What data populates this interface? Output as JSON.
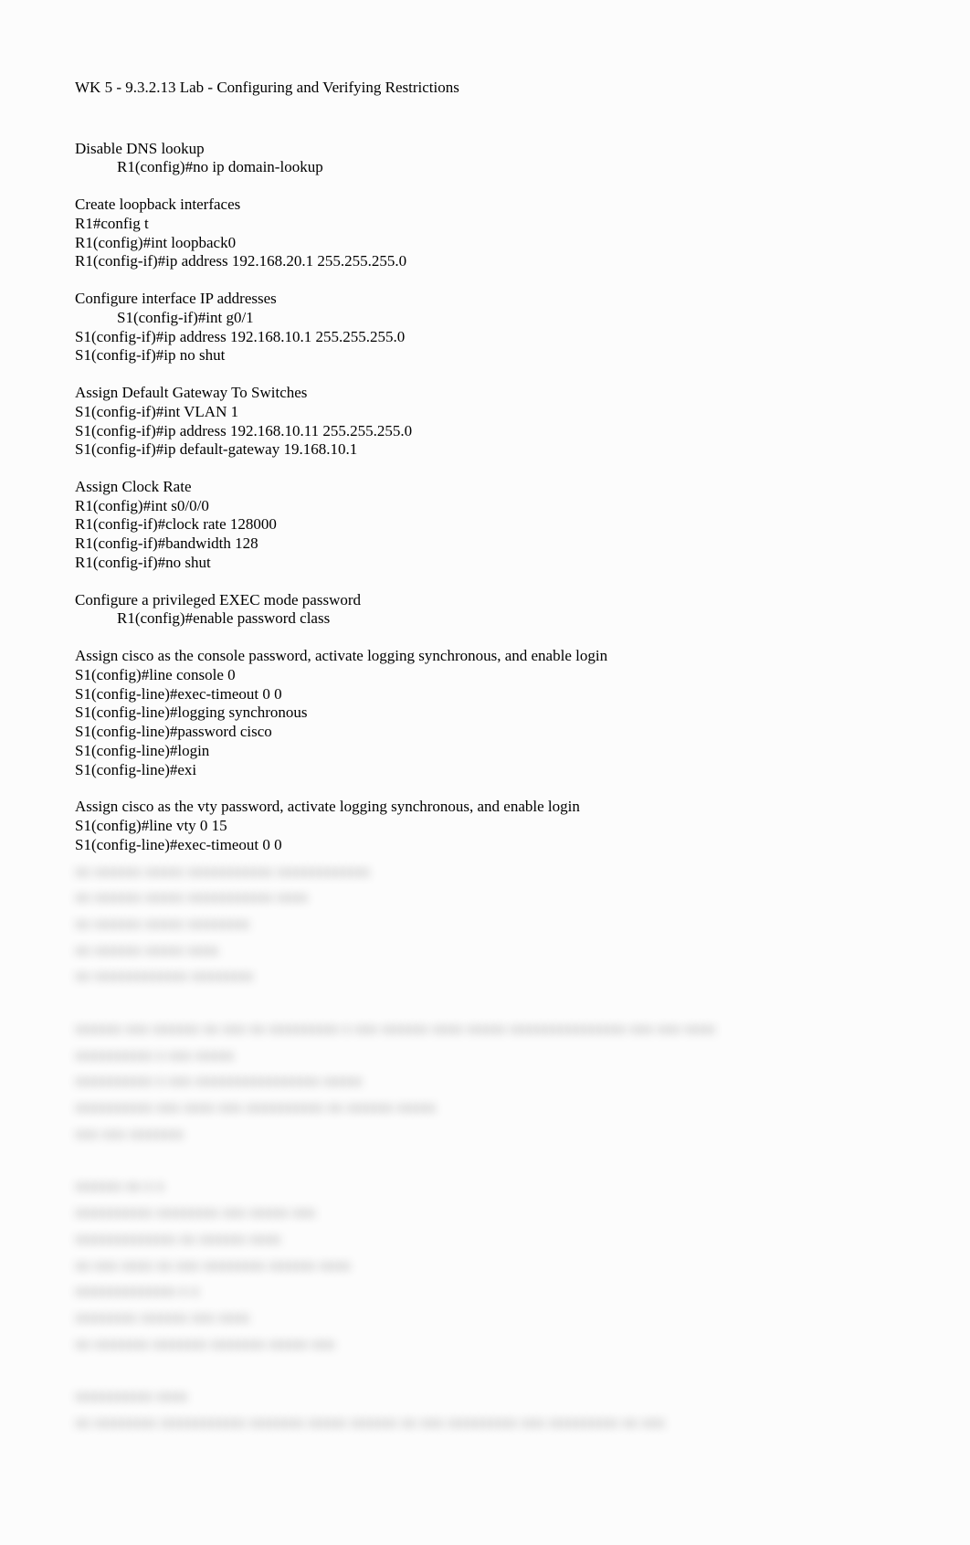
{
  "title": "WK 5 - 9.3.2.13 Lab - Configuring and Verifying Restrictions",
  "sections": [
    {
      "heading": "Disable DNS lookup",
      "indented": true,
      "lines": [
        "R1(config)#no ip domain-lookup"
      ]
    },
    {
      "heading": "Create loopback interfaces",
      "lines": [
        "R1#config t",
        "R1(config)#int loopback0",
        "R1(config-if)#ip address 192.168.20.1 255.255.255.0"
      ]
    },
    {
      "heading": "Configure interface IP addresses",
      "indentFirst": true,
      "lines": [
        "S1(config-if)#int g0/1",
        "S1(config-if)#ip address 192.168.10.1 255.255.255.0",
        "S1(config-if)#ip no shut"
      ]
    },
    {
      "heading": "Assign Default Gateway To Switches",
      "lines": [
        "S1(config-if)#int VLAN 1",
        "S1(config-if)#ip address 192.168.10.11 255.255.255.0",
        "S1(config-if)#ip default-gateway 19.168.10.1"
      ]
    },
    {
      "heading": "Assign Clock Rate",
      "lines": [
        "R1(config)#int s0/0/0",
        "R1(config-if)#clock rate 128000",
        "R1(config-if)#bandwidth 128",
        "R1(config-if)#no shut"
      ]
    },
    {
      "heading": "Configure a privileged EXEC mode password",
      "indented": true,
      "lines": [
        "R1(config)#enable password class"
      ]
    },
    {
      "heading": "Assign cisco as the console password, activate logging synchronous, and enable login",
      "lines": [
        "S1(config)#line console 0",
        "S1(config-line)#exec-timeout 0 0",
        "S1(config-line)#logging synchronous",
        "S1(config-line)#password cisco",
        "S1(config-line)#login",
        "S1(config-line)#exi"
      ]
    },
    {
      "heading": "Assign cisco as the vty password, activate logging synchronous, and enable login",
      "lines": [
        "S1(config)#line vty 0 15",
        "S1(config-line)#exec-timeout 0 0"
      ]
    }
  ],
  "blurred_placeholder": [
    "xx xxxxxx xxxxx xxxxxxxxxxx xxxxxxxxxxxx",
    "xx xxxxxx xxxxx xxxxxxxxxxx xxxx",
    "xx xxxxxx xxxxx xxxxxxxx",
    "xx xxxxxx xxxxx xxxx",
    "xx xxxxxxxxxxxx xxxxxxxx",
    "",
    "xxxxxx xxx xxxxxx xx xxx xx xxxxxxxxx x xxx xxxxxx xxxx xxxxx xxxxxxxxxxxxxxx xxx xxx xxxx",
    "xxxxxxxxxx x xxx xxxxx",
    "xxxxxxxxxx x xxx xxxxxxxxxxxxxxxx xxxxx",
    "xxxxxxxxxx xxx xxxx xxx xxxxxxxxxx xx xxxxxx xxxxx",
    "xxx xxx xxxxxxx",
    "",
    "xxxxxx xx x x",
    "xxxxxxxxxx xxxxxxxx xxx xxxxx xxx",
    "xxxxxxxxxxxxx xx xxxxxx xxxx",
    "xx xxx xxxx xx xxx xxxxxxxx xxxxxx xxxx",
    "xxxxxxxxxxxxx x x",
    "xxxxxxxx xxxxxx xxx xxxx",
    "xx xxxxxxx xxxxxxx xxxxxxx xxxxx xxx",
    "",
    "xxxxxxxxxx xxxx",
    "xx xxxxxxxx xxxxxxxxxxx xxxxxxx xxxxx xxxxxx xx xxx xxxxxxxxx xxx xxxxxxxxx xx xxx"
  ]
}
